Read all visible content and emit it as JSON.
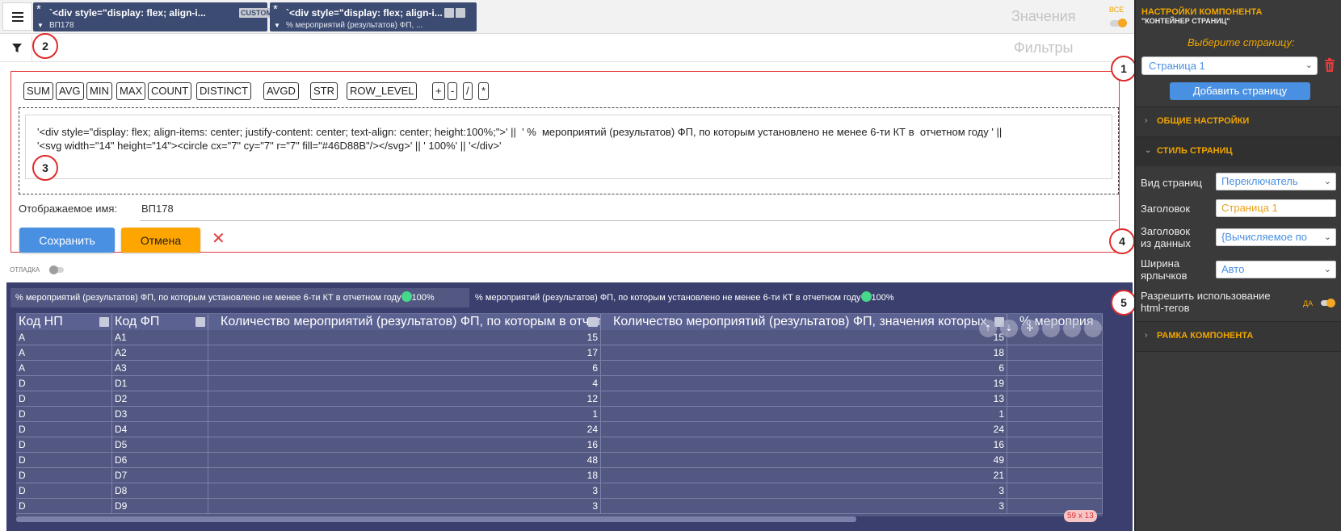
{
  "toolbar": {
    "pill1": {
      "title": "`<div style=\"display: flex; align-i...",
      "tag": "CUSTOM*",
      "subtitle": "ВП178"
    },
    "pill2": {
      "title": "`<div style=\"display: flex; align-i...",
      "subtitle": "% мероприятий (результатов) ФП, ..."
    },
    "values_label": "Значения",
    "all_label": "ВСЕ",
    "filters_label": "Фильтры"
  },
  "badges": [
    "1",
    "2",
    "3",
    "4",
    "5"
  ],
  "editor": {
    "functions": [
      "SUM",
      "AVG",
      "MIN",
      "MAX",
      "COUNT",
      "DISTINCT",
      "AVGD",
      "STR",
      "ROW_LEVEL",
      "+",
      "-",
      "/",
      "*"
    ],
    "formula": "'<div style=\"display: flex; align-items: center; justify-content: center; text-align: center; height:100%;\">' ||  ' %  мероприятий (результатов) ФП, по которым установлено не менее 6-ти КТ в  отчетном году ' ||\n'<svg width=\"14\" height=\"14\"><circle cx=\"7\" cy=\"7\" r=\"7\" fill=\"#46D88B\"/></svg>' || ' 100%' || '</div>'",
    "display_name_label": "Отображаемое имя:",
    "display_name_value": "ВП178",
    "save_label": "Сохранить",
    "cancel_label": "Отмена"
  },
  "debug_label": "ОТЛАДКА",
  "page_tabs": [
    {
      "text": "% мероприятий (результатов) ФП, по которым установлено не менее 6-ти КТ в отчетном году",
      "value": "100%"
    },
    {
      "text": "% мероприятий (результатов) ФП, по которым установлено не менее 6-ти КТ в отчетном году",
      "value": "100%"
    }
  ],
  "dot_color": "#46D88B",
  "grid": {
    "columns": [
      "Код НП",
      "Код ФП",
      "Количество мероприятий (результатов) ФП, по которым в отчетном",
      "Количество мероприятий (результатов) ФП, значения которых",
      "% мероприя"
    ],
    "rows": [
      [
        "A",
        "A1",
        "15",
        "15"
      ],
      [
        "A",
        "A2",
        "17",
        "18"
      ],
      [
        "A",
        "A3",
        "6",
        "6"
      ],
      [
        "D",
        "D1",
        "4",
        "19"
      ],
      [
        "D",
        "D2",
        "12",
        "13"
      ],
      [
        "D",
        "D3",
        "1",
        "1"
      ],
      [
        "D",
        "D4",
        "24",
        "24"
      ],
      [
        "D",
        "D5",
        "16",
        "16"
      ],
      [
        "D",
        "D6",
        "48",
        "49"
      ],
      [
        "D",
        "D7",
        "18",
        "21"
      ],
      [
        "D",
        "D8",
        "3",
        "3"
      ],
      [
        "D",
        "D9",
        "3",
        "3"
      ]
    ],
    "size": "59 x 13"
  },
  "panel": {
    "title": "НАСТРОЙКИ КОМПОНЕНТА",
    "subtitle": "\"КОНТЕЙНЕР СТРАНИЦ\"",
    "choose_page": "Выберите страницу:",
    "page_select": "Страница 1",
    "add_page": "Добавить страницу",
    "sections": {
      "general": "ОБЩИЕ НАСТРОЙКИ",
      "page_style": "СТИЛЬ СТРАНИЦ",
      "frame": "РАМКА КОМПОНЕНТА"
    },
    "props": {
      "view_label": "Вид страниц",
      "view_value": "Переключатель",
      "header_label": "Заголовок",
      "header_value": "Страница 1",
      "header_data_label_1": "Заголовок",
      "header_data_label_2": "из данных",
      "header_data_value": "{Вычисляемое по",
      "tab_width_label_1": "Ширина",
      "tab_width_label_2": "ярлычков",
      "tab_width_value": "Авто",
      "html_label_1": "Разрешить использование",
      "html_label_2": "html-тегов",
      "html_value": "ДА"
    }
  },
  "colors": {
    "accent": "#f0a500",
    "primary": "#4a90e2",
    "danger": "#e23b3b",
    "grid_bg": "#525882",
    "container_bg": "#3a3f6e"
  }
}
